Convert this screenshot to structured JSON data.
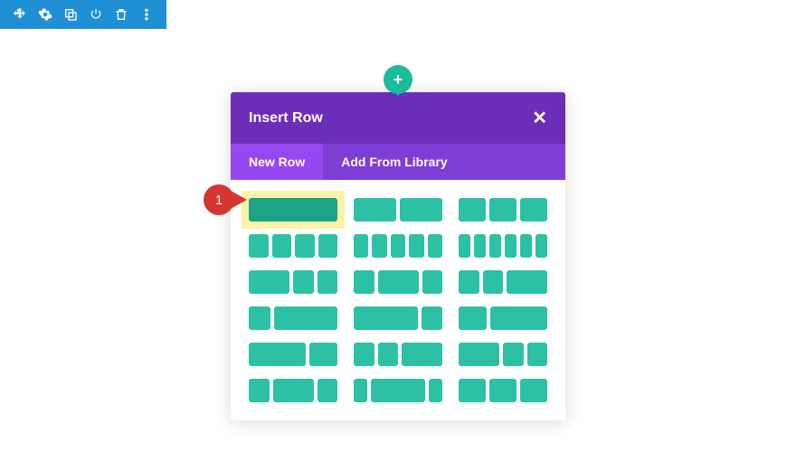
{
  "toolbar": {
    "icons": [
      "move-icon",
      "settings-icon",
      "duplicate-icon",
      "power-icon",
      "delete-icon",
      "more-icon"
    ]
  },
  "modal": {
    "title": "Insert Row",
    "close": "✕",
    "tabs": {
      "new_row": "New Row",
      "add_library": "Add From Library"
    }
  },
  "callout": {
    "number": "1"
  },
  "layouts": [
    [
      1
    ],
    [
      1,
      1
    ],
    [
      1,
      1,
      1
    ],
    [
      1,
      1,
      1,
      1
    ],
    [
      1,
      1,
      1,
      1,
      1
    ],
    [
      1,
      1,
      1,
      1,
      1,
      1
    ],
    [
      2,
      1,
      1
    ],
    [
      1,
      2,
      1
    ],
    [
      1,
      1,
      2
    ],
    [
      1,
      3
    ],
    [
      3,
      1
    ],
    [
      1,
      2
    ],
    [
      2,
      1
    ],
    [
      1,
      1,
      2
    ],
    [
      2,
      1,
      1
    ],
    [
      1,
      2,
      1
    ],
    [
      1,
      4,
      1
    ],
    [
      1,
      1,
      1
    ]
  ],
  "colors": {
    "accent": "#2cc1a5",
    "primary": "#6c2eb9",
    "toolbar": "#1f90d4",
    "callout": "#d33730"
  }
}
